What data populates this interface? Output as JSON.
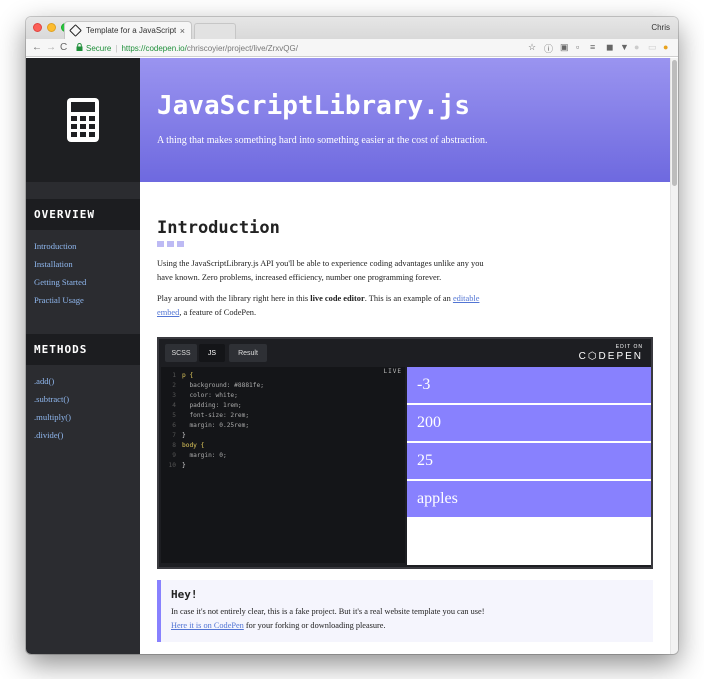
{
  "browser": {
    "tab_title": "Template for a JavaScript Libr",
    "tab_close": "×",
    "user": "Chris",
    "nav_back": "←",
    "nav_forward": "→",
    "nav_reload": "C",
    "secure_label": "Secure",
    "url_host": "https://codepen.io/",
    "url_path": "chriscoyier/project/live/ZrxvQG/"
  },
  "sidebar": {
    "overview_heading": "OVERVIEW",
    "overview_items": [
      "Introduction",
      "Installation",
      "Getting Started",
      "Practial Usage"
    ],
    "methods_heading": "METHODS",
    "methods_items": [
      ".add()",
      ".subtract()",
      ".multiply()",
      ".divide()"
    ]
  },
  "hero": {
    "title": "JavaScriptLibrary.js",
    "subtitle": "A thing that makes something hard into something easier at the cost of abstraction."
  },
  "intro": {
    "title": "Introduction",
    "paragraph1": "Using the JavaScriptLibrary.js API you'll be able to experience coding advantages unlike any you have known. Zero problems, increased efficiency, number one programming forever.",
    "p2_before": "Play around with the library right here in this ",
    "p2_bold": "live code editor",
    "p2_middle": ". This is an example of an ",
    "p2_link": "editable embed",
    "p2_after": ", a feature of CodePen."
  },
  "embed": {
    "tabs": [
      "SCSS",
      "JS",
      "Result"
    ],
    "edit_on": "EDIT ON",
    "brand": "C⬡DEPEN",
    "live_badge": "LIVE",
    "code_lines": [
      {
        "n": "1",
        "text": "p {",
        "cls": "sel"
      },
      {
        "n": "2",
        "text": "  background: #8881fe;",
        "cls": "prop"
      },
      {
        "n": "3",
        "text": "  color: white;",
        "cls": "prop"
      },
      {
        "n": "4",
        "text": "  padding: 1rem;",
        "cls": "prop"
      },
      {
        "n": "5",
        "text": "  font-size: 2rem;",
        "cls": "prop"
      },
      {
        "n": "6",
        "text": "  margin: 0.25rem;",
        "cls": "prop"
      },
      {
        "n": "7",
        "text": "}",
        "cls": "brace"
      },
      {
        "n": "8",
        "text": "body {",
        "cls": "sel"
      },
      {
        "n": "9",
        "text": "  margin: 0;",
        "cls": "prop"
      },
      {
        "n": "10",
        "text": "}",
        "cls": "brace"
      }
    ],
    "results": [
      "-3",
      "200",
      "25",
      "apples"
    ]
  },
  "callout": {
    "title": "Hey!",
    "text_before": "In case it's not entirely clear, this is a fake project. But it's a real website template you can use! ",
    "link": "Here it is on CodePen",
    "text_after": " for your forking or downloading pleasure."
  },
  "colors": {
    "accent": "#8881fe",
    "sidebar_bg": "#2b2c30",
    "sidebar_link": "#8fb7ee",
    "hero_top": "#9a94f0",
    "hero_bottom": "#6e69df"
  },
  "icons": {
    "sidebar_logo": "calculator-icon",
    "lock": "lock-icon"
  }
}
